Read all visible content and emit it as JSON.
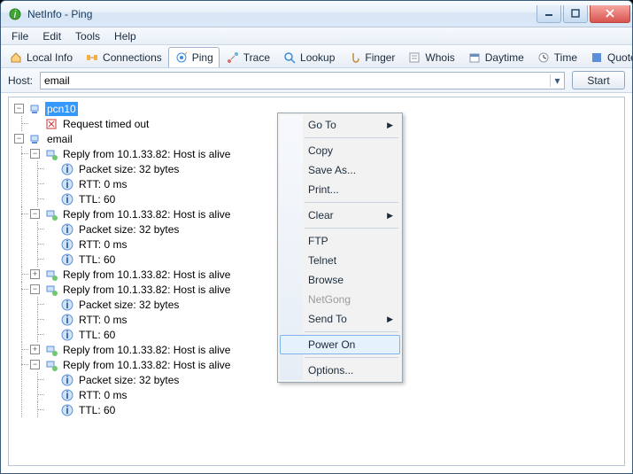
{
  "window": {
    "title": "NetInfo - Ping"
  },
  "menubar": [
    "File",
    "Edit",
    "Tools",
    "Help"
  ],
  "tabs": [
    {
      "label": "Local Info"
    },
    {
      "label": "Connections"
    },
    {
      "label": "Ping"
    },
    {
      "label": "Trace"
    },
    {
      "label": "Lookup"
    },
    {
      "label": "Finger"
    },
    {
      "label": "Whois"
    },
    {
      "label": "Daytime"
    },
    {
      "label": "Time"
    },
    {
      "label": "Quote"
    }
  ],
  "hostbar": {
    "label": "Host:",
    "value": "email",
    "start": "Start"
  },
  "tree": {
    "root1": "pcn10",
    "root1_child": "Request timed out",
    "root2": "email",
    "reply": "Reply from 10.1.33.82: Host is alive",
    "packet": "Packet size: 32 bytes",
    "rtt": "RTT: 0 ms",
    "ttl": "TTL: 60"
  },
  "context_menu": {
    "goto": "Go To",
    "copy": "Copy",
    "saveas": "Save As...",
    "print": "Print...",
    "clear": "Clear",
    "ftp": "FTP",
    "telnet": "Telnet",
    "browse": "Browse",
    "netgong": "NetGong",
    "sendto": "Send To",
    "poweron": "Power On",
    "options": "Options..."
  }
}
